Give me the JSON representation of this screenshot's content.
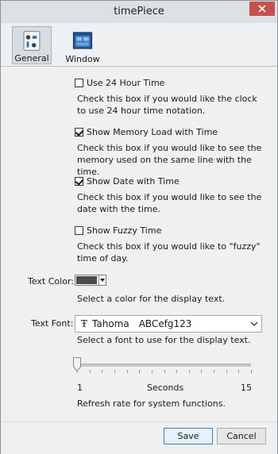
{
  "window": {
    "title": "timePiece",
    "close_icon": "close-icon"
  },
  "toolbar": {
    "tabs": [
      {
        "label": "General",
        "icon": "general-settings-icon",
        "active": true
      },
      {
        "label": "Window",
        "icon": "window-icon",
        "active": false
      }
    ]
  },
  "options": [
    {
      "label": "Use 24 Hour Time",
      "checked": false,
      "description": "Check this box if you would like the clock to use 24 hour time notation."
    },
    {
      "label": "Show Memory Load with Time",
      "checked": true,
      "description": "Check this box if you would like to see the memory used on the same line with the time."
    },
    {
      "label": "Show Date with Time",
      "checked": true,
      "description": "Check this box if you would like to see the date with the time."
    },
    {
      "label": "Show Fuzzy Time",
      "checked": false,
      "description": "Check this box if you would like to \"fuzzy\" time of day."
    }
  ],
  "text_color": {
    "label": "Text Color:",
    "value": "#4a4a4a",
    "description": "Select a color for the display text."
  },
  "text_font": {
    "label": "Text Font:",
    "font_name": "Tahoma",
    "sample": "ABCefg123",
    "description": "Select a font to use for the display text."
  },
  "refresh": {
    "min": "1",
    "unit": "Seconds",
    "max": "15",
    "value": 1,
    "description": "Refresh rate for system functions."
  },
  "footer": {
    "save_label": "Save",
    "cancel_label": "Cancel"
  }
}
